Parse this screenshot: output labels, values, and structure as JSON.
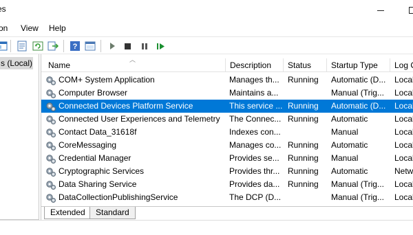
{
  "window": {
    "title": "es",
    "minimize_label": "—",
    "maximize_label": ""
  },
  "menu": [
    "on",
    "View",
    "Help"
  ],
  "left_pane": {
    "selected_node": "s (Local)"
  },
  "columns": [
    "Name",
    "Description",
    "Status",
    "Startup Type",
    "Log O"
  ],
  "services": [
    {
      "name": "COM+ System Application",
      "description": "Manages th...",
      "status": "Running",
      "startup": "Automatic (D...",
      "logon": "Local",
      "selected": false
    },
    {
      "name": "Computer Browser",
      "description": "Maintains a...",
      "status": "",
      "startup": "Manual (Trig...",
      "logon": "Local",
      "selected": false
    },
    {
      "name": "Connected Devices Platform Service",
      "description": "This service ...",
      "status": "Running",
      "startup": "Automatic (D...",
      "logon": "Local",
      "selected": true
    },
    {
      "name": "Connected User Experiences and Telemetry",
      "description": "The Connec...",
      "status": "Running",
      "startup": "Automatic",
      "logon": "Local",
      "selected": false
    },
    {
      "name": "Contact Data_31618f",
      "description": "Indexes con...",
      "status": "",
      "startup": "Manual",
      "logon": "Local",
      "selected": false
    },
    {
      "name": "CoreMessaging",
      "description": "Manages co...",
      "status": "Running",
      "startup": "Automatic",
      "logon": "Local",
      "selected": false
    },
    {
      "name": "Credential Manager",
      "description": "Provides se...",
      "status": "Running",
      "startup": "Manual",
      "logon": "Local",
      "selected": false
    },
    {
      "name": "Cryptographic Services",
      "description": "Provides thr...",
      "status": "Running",
      "startup": "Automatic",
      "logon": "Netw",
      "selected": false
    },
    {
      "name": "Data Sharing Service",
      "description": "Provides da...",
      "status": "Running",
      "startup": "Manual (Trig...",
      "logon": "Local",
      "selected": false
    },
    {
      "name": "DataCollectionPublishingService",
      "description": "The DCP (D...",
      "status": "",
      "startup": "Manual (Trig...",
      "logon": "Local",
      "selected": false
    }
  ],
  "tabs": [
    "Extended",
    "Standard"
  ],
  "toolbar_icons": [
    "console-tree-icon",
    "properties-icon",
    "refresh-icon",
    "export-icon",
    "help-icon",
    "console-icon",
    "play-icon",
    "stop-icon",
    "pause-icon",
    "restart-icon"
  ],
  "colors": {
    "selection": "#0078d7",
    "play": "#1a8f2f",
    "stop": "#333333"
  }
}
